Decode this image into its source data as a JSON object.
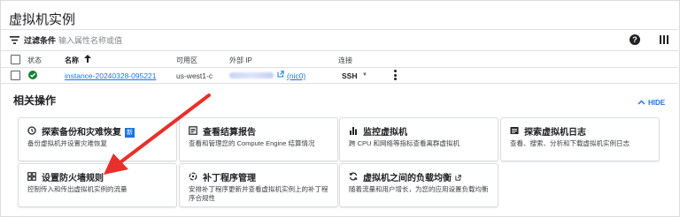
{
  "page": {
    "title": "虚拟机实例"
  },
  "filter": {
    "label": "过滤条件",
    "placeholder": "输入属性名称或值"
  },
  "table": {
    "headers": {
      "status": "状态",
      "name": "名称",
      "zone": "可用区",
      "external_ip": "外部 IP",
      "connect": "连接"
    },
    "rows": [
      {
        "name": "instance-20240328-095221",
        "zone": "us-west1-c",
        "nic": "(nic0)",
        "connect": "SSH"
      }
    ]
  },
  "related": {
    "title": "相关操作",
    "hide_label": "HIDE",
    "cards": [
      {
        "title": "探索备份和灾难恢复",
        "badge": "新",
        "desc": "备份虚拟机并设置灾难恢复",
        "icon": "shield-backup-icon"
      },
      {
        "title": "查看结算报告",
        "desc": "查看和管理您的 Compute Engine 结算情况",
        "icon": "receipt-icon"
      },
      {
        "title": "监控虚拟机",
        "desc": "跨 CPU 和网络等指标查看离群虚拟机",
        "icon": "bar-chart-icon"
      },
      {
        "title": "探索虚拟机日志",
        "desc": "查看、搜索、分析和下载虚拟机实例日志",
        "icon": "logs-icon"
      },
      {
        "title": "设置防火墙规则",
        "desc": "控制传入和传出虚拟机实例的流量",
        "icon": "firewall-icon"
      },
      {
        "title": "补丁程序管理",
        "desc": "安排补丁程序更新并查看虚拟机实例上的补丁程序合规性",
        "icon": "patch-icon"
      },
      {
        "title": "虚拟机之间的负载均衡",
        "desc": "随着流量和用户增长，为您的应用设置负载均衡",
        "icon": "sync-icon",
        "external": true
      }
    ]
  },
  "colors": {
    "accent": "#1a73e8",
    "status_ok": "#188038",
    "annotation_arrow": "#e8302a"
  }
}
